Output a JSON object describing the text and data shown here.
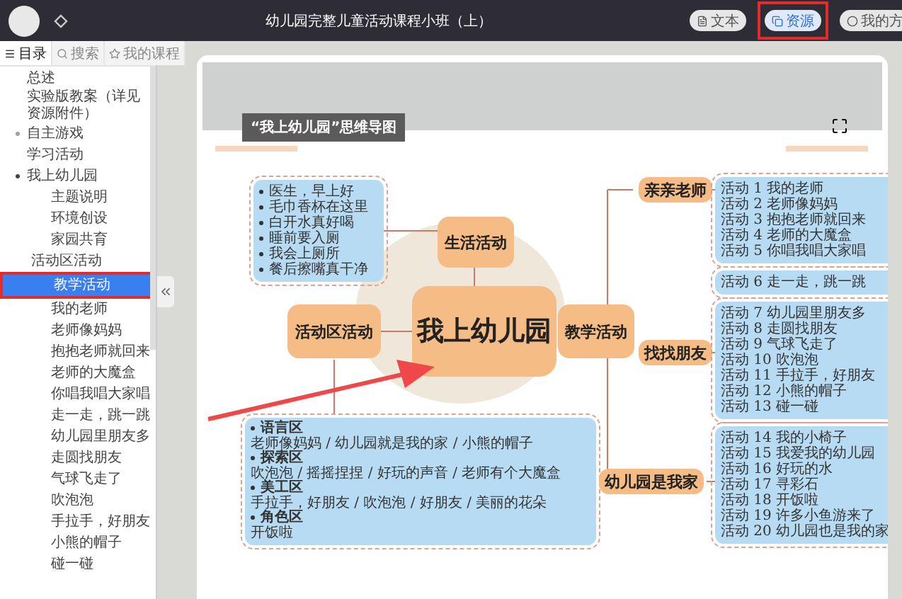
{
  "window": {
    "title": "幼儿园完整儿童活动课程小班（上）"
  },
  "view_buttons": [
    {
      "label": "文本",
      "selected": false
    },
    {
      "label": "资源",
      "selected": true
    },
    {
      "label": "我的方",
      "selected": false
    }
  ],
  "sidebar": {
    "tabs": [
      {
        "label": "目录",
        "selected": true
      },
      {
        "label": "搜索",
        "selected": false
      },
      {
        "label": "我的课程",
        "selected": false
      }
    ],
    "items": [
      {
        "label": "总述",
        "selected": false
      },
      {
        "label": "实验版教案（详见资源附件）",
        "selected": false
      },
      {
        "label": "自主游戏",
        "selected": false,
        "expanded": false
      },
      {
        "label": "学习活动",
        "selected": false
      },
      {
        "label": "我上幼儿园",
        "selected": false,
        "expanded": true,
        "children": [
          {
            "label": "主题说明",
            "selected": false
          },
          {
            "label": "环境创设",
            "selected": false
          },
          {
            "label": "家园共育",
            "selected": false
          },
          {
            "label": "活动区活动",
            "selected": false,
            "kind": "section"
          },
          {
            "label": "教学活动",
            "selected": true
          },
          {
            "label": "我的老师",
            "selected": false
          },
          {
            "label": "老师像妈妈",
            "selected": false
          },
          {
            "label": "抱抱老师就回来",
            "selected": false
          },
          {
            "label": "老师的大魔盒",
            "selected": false
          },
          {
            "label": "你唱我唱大家唱",
            "selected": false
          },
          {
            "label": "走一走，跳一跳",
            "selected": false
          },
          {
            "label": "幼儿园里朋友多",
            "selected": false
          },
          {
            "label": "走圆找朋友",
            "selected": false
          },
          {
            "label": "气球飞走了",
            "selected": false
          },
          {
            "label": "吹泡泡",
            "selected": false
          },
          {
            "label": "手拉手，好朋友",
            "selected": false
          },
          {
            "label": "小熊的帽子",
            "selected": false
          },
          {
            "label": "碰一碰",
            "selected": false
          }
        ]
      }
    ]
  },
  "mindmap": {
    "title": "“我上幼儿园”思维导图",
    "center": "我上幼儿园",
    "life": {
      "label": "生活活动",
      "items": [
        "医生，早上好",
        "毛巾香杯在这里",
        "白开水真好喝",
        "睡前要入厕",
        "我会上厕所",
        "餐后擦嘴真干净"
      ]
    },
    "area": {
      "label": "活动区活动",
      "zones": [
        {
          "name": "语言区",
          "activities": "老师像妈妈 / 幼儿园就是我的家 / 小熊的帽子"
        },
        {
          "name": "探索区",
          "activities": "吹泡泡 / 摇摇捏捏 / 好玩的声音 / 老师有个大魔盒"
        },
        {
          "name": "美工区",
          "activities": "手拉手，好朋友 / 吹泡泡 / 好朋友 / 美丽的花朵"
        },
        {
          "name": "角色区",
          "activities": "开饭啦"
        }
      ]
    },
    "teaching": {
      "label": "教学活动",
      "groups": [
        {
          "label": "亲亲老师",
          "boxes": [
            [
              "活动 1 我的老师",
              "活动 2 老师像妈妈",
              "活动 3 抱抱老师就回来",
              "活动 4 老师的大魔盒",
              "活动 5 你唱我唱大家唱"
            ],
            [
              "活动 6 走一走，跳一跳"
            ]
          ]
        },
        {
          "label": "找找朋友",
          "boxes": [
            [
              "活动 7 幼儿园里朋友多",
              "活动 8 走圆找朋友",
              "活动 9 气球飞走了",
              "活动 10 吹泡泡",
              "活动 11 手拉手，好朋友",
              "活动 12 小熊的帽子",
              "活动 13 碰一碰"
            ]
          ]
        },
        {
          "label": "幼儿园是我家",
          "boxes": [
            [
              "活动 14 我的小椅子",
              "活动 15 我爱我的幼儿园",
              "活动 16 好玩的水",
              "活动 17 寻彩石",
              "活动 18 开饭啦",
              "活动 19 许多小鱼游来了",
              "活动 20 幼儿园也是我的家"
            ]
          ]
        }
      ]
    }
  }
}
